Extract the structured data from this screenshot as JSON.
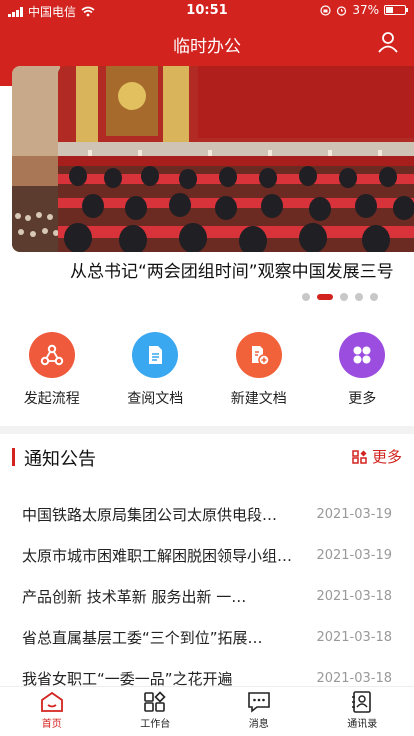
{
  "status": {
    "carrier": "中国电信",
    "time": "10:51",
    "battery": "37%"
  },
  "header": {
    "title": "临时办公"
  },
  "banner": {
    "caption": "从总书记“两会团组时间”观察中国发展三号",
    "active_index": 1,
    "slide_count": 5
  },
  "actions": [
    {
      "label": "发起流程",
      "icon": "workflow-icon",
      "color": "#f05a3c"
    },
    {
      "label": "查阅文档",
      "icon": "document-icon",
      "color": "#3aa8f0"
    },
    {
      "label": "新建文档",
      "icon": "new-document-icon",
      "color": "#f2623a"
    },
    {
      "label": "更多",
      "icon": "more-grid-icon",
      "color": "#9b4de0"
    }
  ],
  "notices": {
    "title": "通知公告",
    "more_label": "更多",
    "items": [
      {
        "title": "中国铁路太原局集团公司太原供电段…",
        "date": "2021-03-19"
      },
      {
        "title": "太原市城市困难职工解困脱困领导小组…",
        "date": "2021-03-19"
      },
      {
        "title": "产品创新 技术革新 服务出新 一…",
        "date": "2021-03-18"
      },
      {
        "title": "省总直属基层工委“三个到位”拓展…",
        "date": "2021-03-18"
      },
      {
        "title": "我省女职工“一委一品”之花开遍",
        "date": "2021-03-18"
      }
    ]
  },
  "tabs": [
    {
      "label": "首页",
      "icon": "home-icon",
      "active": true
    },
    {
      "label": "工作台",
      "icon": "workbench-icon",
      "active": false
    },
    {
      "label": "消息",
      "icon": "message-icon",
      "active": false
    },
    {
      "label": "通讯录",
      "icon": "contacts-icon",
      "active": false
    }
  ],
  "colors": {
    "brand_red": "#d3231e",
    "divider": "#f2f2f2"
  }
}
